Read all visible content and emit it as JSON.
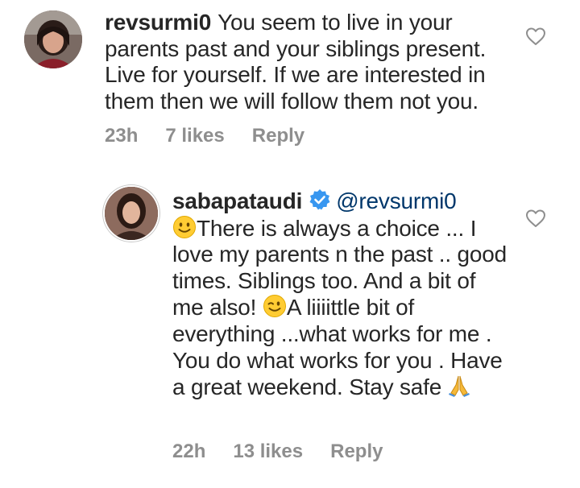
{
  "comments": [
    {
      "username": "revsurmi0",
      "text": "You seem to live in your parents past and your siblings present. Live for yourself. If we are interested in them then we will follow them not you.",
      "time": "23h",
      "likes": "7 likes",
      "reply": "Reply"
    },
    {
      "username": "sabapataudi",
      "verified": true,
      "mention": "@revsurmi0",
      "text_1": "There is always a choice ...",
      "text_2": "I love my parents n the past .. good times.  Siblings too. And a bit of me also!",
      "text_3": "A liiiittle bit of everything ...what works for me . You do what works for you . Have a great weekend.  Stay safe",
      "time": "22h",
      "likes": "13 likes",
      "reply": "Reply"
    }
  ],
  "icons": {
    "like": "heart-outline-icon",
    "verified": "verified-badge-icon",
    "smile": "slightly-smiling-face-emoji",
    "wink": "winking-face-emoji",
    "pray": "folded-hands-emoji"
  },
  "colors": {
    "verified": "#3897f0",
    "mention": "#00376b",
    "meta": "#8e8e8e",
    "text": "#262626"
  }
}
